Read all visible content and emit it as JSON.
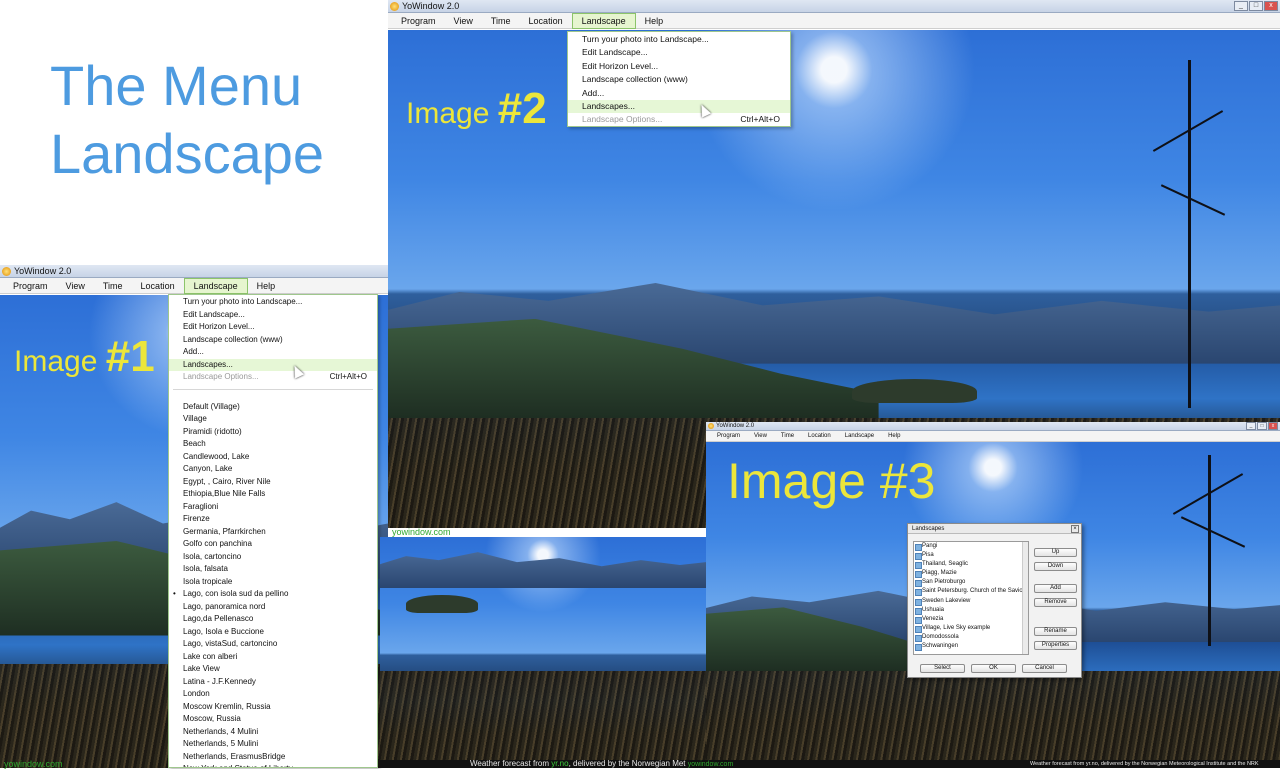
{
  "title": {
    "line1": "The Menu",
    "line2": "Landscape"
  },
  "labels": {
    "image1_word": "Image",
    "image1_num": "#1",
    "image2_word": "Image",
    "image2_num": "#2",
    "image3": "Image #3"
  },
  "window": {
    "title": "YoWindow 2.0",
    "menu": [
      "Program",
      "View",
      "Time",
      "Location",
      "Landscape",
      "Help"
    ]
  },
  "landscape_menu": {
    "items": [
      {
        "label": "Turn your photo into Landscape..."
      },
      {
        "label": "Edit Landscape..."
      },
      {
        "label": "Edit Horizon Level..."
      },
      {
        "label": "Landscape collection (www)"
      },
      {
        "label": "Add..."
      },
      {
        "label": "Landscapes...",
        "highlighted": true
      },
      {
        "label": "Landscape Options...",
        "disabled": true,
        "shortcut": "Ctrl+Alt+O"
      }
    ],
    "landscapes_list": [
      "Default (Village)",
      "Village",
      "Piramidi (ridotto)",
      "Beach",
      "Candlewood, Lake",
      "Canyon, Lake",
      "Egypt, , Cairo, River Nile",
      "Ethiopia,Blue Nile Falls",
      "Faraglioni",
      "Firenze",
      "Germania, Pfarrkirchen",
      "Golfo con panchina",
      "Isola, cartoncino",
      "Isola, falsata",
      "Isola tropicale",
      "Lago, con isola sud da pellino",
      "Lago, panoramica nord",
      "Lago,da Pellenasco",
      "Lago, Isola e Buccione",
      "Lago, vistaSud, cartoncino",
      "Lake con alberi",
      "Lake View",
      "Latina - J.F.Kennedy",
      "London",
      "Moscow Kremlin, Russia",
      "Moscow, Russia",
      "Netherlands, 4 Mulini",
      "Netherlands, 5 Mulini",
      "Netherlands, ErasmusBridge",
      "New York and Statue of Liberty"
    ],
    "selected_index": 15
  },
  "footer": {
    "site": "yowindow.com",
    "forecast_prefix": "Weather forecast from",
    "forecast_source": "yr.no",
    "forecast_suffix": ", delivered by the Norwegian Met",
    "forecast_small": "Weather forecast from yr.no, delivered by the Norwegian Meteorological Institute and the NRK"
  },
  "dialog": {
    "title": "Landscapes",
    "items": [
      "Pangi",
      "Pisa",
      "Thailand, Seaglic",
      "Piagg, Mazie",
      "San Pietroburgo",
      "Saint Petersburg. Church of the Savior o",
      "Sweden Lakeview",
      "Ushuaia",
      "Venezia",
      "Village, Live Sky example",
      "Domodossola",
      "Schwaningen"
    ],
    "buttons_right": [
      "Up",
      "Down",
      "Add",
      "Remove",
      "Rename",
      "Properties"
    ],
    "buttons_bottom": [
      "Select",
      "OK",
      "Cancel"
    ]
  }
}
